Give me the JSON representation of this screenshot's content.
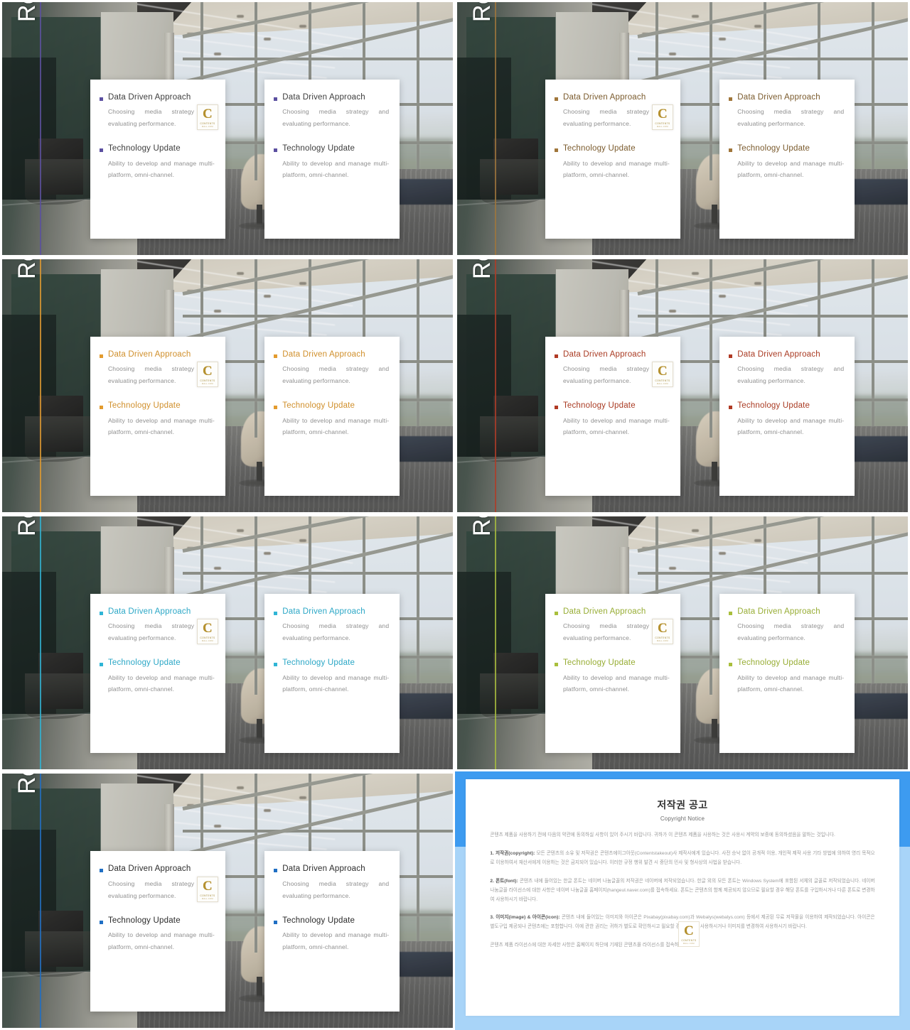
{
  "deck": {
    "slide_title": "Research",
    "card_items": [
      {
        "title": "Data Driven Approach",
        "body": "Choosing media strategy and evaluating performance."
      },
      {
        "title": "Technology Update",
        "body": "Ability to develop and manage multi-platform, omni-channel."
      }
    ],
    "logo": {
      "letter": "C",
      "line1": "CONTENTS",
      "line2": "MALL.COM"
    }
  },
  "slides": [
    {
      "index": 1,
      "accent": "#5b4fa0",
      "title_color": "#3c3c3c"
    },
    {
      "index": 2,
      "accent": "#a0763a",
      "title_color": "#7a5a2c"
    },
    {
      "index": 3,
      "accent": "#e39b2e",
      "title_color": "#d08f2b"
    },
    {
      "index": 4,
      "accent": "#b03a24",
      "title_color": "#a93a22"
    },
    {
      "index": 5,
      "accent": "#2fb5d6",
      "title_color": "#2ba7c6"
    },
    {
      "index": 6,
      "accent": "#a9bf3c",
      "title_color": "#97ad34"
    },
    {
      "index": 7,
      "accent": "#1f6fc4",
      "title_color": "#2a2a2a"
    }
  ],
  "copyright": {
    "title": "저작권 공고",
    "subtitle": "Copyright Notice",
    "intro": "콘텐츠 제품을 사용하기 전에 다음의 약관에 동의하실 사항이 있어 주시기 바랍니다. 귀하가 이 콘텐츠 제품을 사용하는 것은 사용시 계약의 보증에 동의하셨음을 말하는 것입니다.",
    "sections": [
      {
        "heading": "1. 저작권(copyright):",
        "text": "모든 콘텐츠의 소유 및 저작권은 콘텐츠에이그아웃(Contentstakeout)사 제작사에게 있습니다. 사전 승낙 없이 공개적 이용, 개인적 제작 사용 기타 방법에 의하여 영리 목적으로 이용하여서 재산서에게 이용하는 것은 금지되어 있습니다. 이러한 규정 행위 발견 시 중단의 민사 및 형사상의 사법을 받습니다."
      },
      {
        "heading": "2. 폰트(font):",
        "text": "콘텐츠 내에 들어있는 한글 폰트는 네이버 나눔글꼴의 저작권은 네이버에 저작되었습니다. 한글 외의 모든 폰트는 Windows System에 포함된 서체의 글꼴로 저작되었습니다. 네이버 나눔글꼴 라이선스에 대한 사항은 네이버 나눔글꼴 홈페이지(hangeul.naver.com)를 접속하세요. 폰트는 콘텐츠의 함께 제공되지 않으므로 필요할 경우 해당 폰트를 구입하시거나 다른 폰트로 변경하여 사용하시기 바랍니다."
      },
      {
        "heading": "3. 이미지(image) & 아이콘(icon):",
        "text": "콘텐츠 내에 들어있는 이미지와 아이콘은 Pixabay(pixabay.com)과 Webalys(webalys.com) 등에서 제공된 무료 저작물을 이용하여 제작되었습니다. 아이콘은 별도구입 제공되나 콘텐츠에는 포함합니다. 이에 관한 권리는 귀하가 별도로 확인하시고 필요할 경우 아이콘 사용하시거나 이미지를 변경하여 사용하시기 바랍니다."
      }
    ],
    "footer": "콘텐츠 제품 라이선스에 대한 자세한 사항은 홈페이지 하단에 기재된 콘텐츠몰 라이선스를 접속하세요."
  }
}
